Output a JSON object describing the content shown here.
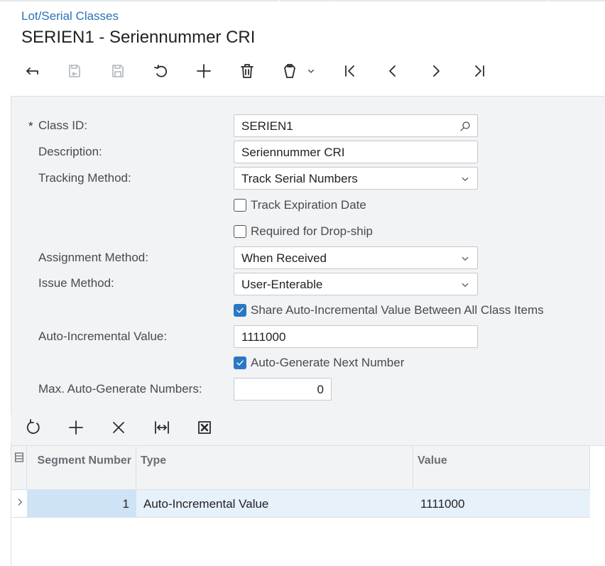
{
  "breadcrumb": "Lot/Serial Classes",
  "title": "SERIEN1 - Seriennummer CRI",
  "toolbar_icons": [
    "back-icon",
    "cancel-icon",
    "save-icon",
    "undo-icon",
    "add-icon",
    "delete-icon",
    "copy-paste-icon",
    "chevron-down-icon",
    "first-record-icon",
    "previous-record-icon",
    "next-record-icon",
    "last-record-icon"
  ],
  "form": {
    "required_mark": "*",
    "class_id": {
      "label": "Class ID:",
      "value": "SERIEN1"
    },
    "description": {
      "label": "Description:",
      "value": "Seriennummer CRI"
    },
    "tracking_method": {
      "label": "Tracking Method:",
      "value": "Track Serial Numbers"
    },
    "track_expiration": {
      "label": "Track Expiration Date",
      "checked": false
    },
    "required_dropship": {
      "label": "Required for Drop-ship",
      "checked": false
    },
    "assignment_method": {
      "label": "Assignment Method:",
      "value": "When Received"
    },
    "issue_method": {
      "label": "Issue Method:",
      "value": "User-Enterable"
    },
    "share_auto_inc": {
      "label": "Share Auto-Incremental Value Between All Class Items",
      "checked": true
    },
    "auto_inc_value": {
      "label": "Auto-Incremental Value:",
      "value": "1111000"
    },
    "auto_generate": {
      "label": "Auto-Generate Next Number",
      "checked": true
    },
    "max_auto_gen": {
      "label": "Max. Auto-Generate Numbers:",
      "value": "0"
    }
  },
  "grid": {
    "toolbar_icons": [
      "refresh-icon",
      "add-row-icon",
      "delete-row-icon",
      "fit-columns-icon",
      "export-excel-icon"
    ],
    "columns": {
      "segment_number": "Segment Number",
      "type": "Type",
      "value": "Value"
    },
    "rows": [
      {
        "segment_number": "1",
        "type": "Auto-Incremental Value",
        "value": "1111000"
      }
    ]
  },
  "colors": {
    "accent": "#2a78c5",
    "link": "#2872b8",
    "panel": "#f2f3f5",
    "row_selected": "#e7f1fa"
  }
}
